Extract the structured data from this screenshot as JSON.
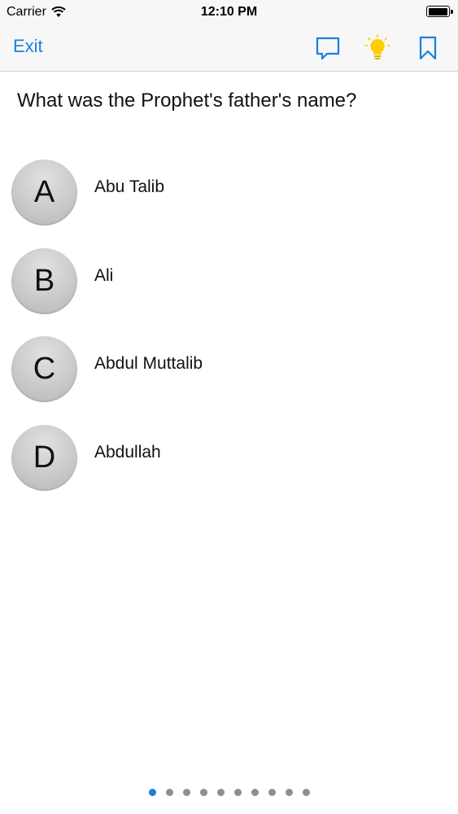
{
  "status_bar": {
    "carrier": "Carrier",
    "time": "12:10 PM",
    "battery_level": 1.0
  },
  "nav": {
    "exit_label": "Exit",
    "icons": [
      "comment-icon",
      "lightbulb-icon",
      "bookmark-icon"
    ],
    "accent_color": "#1a7fe0",
    "lightbulb_color": "#ffcc00"
  },
  "question": {
    "text": "What was the Prophet's father's name?"
  },
  "answers": [
    {
      "letter": "A",
      "text": "Abu Talib"
    },
    {
      "letter": "B",
      "text": "Ali"
    },
    {
      "letter": "C",
      "text": "Abdul Muttalib"
    },
    {
      "letter": "D",
      "text": "Abdullah"
    }
  ],
  "pagination": {
    "total_pages": 10,
    "current_page": 1
  }
}
